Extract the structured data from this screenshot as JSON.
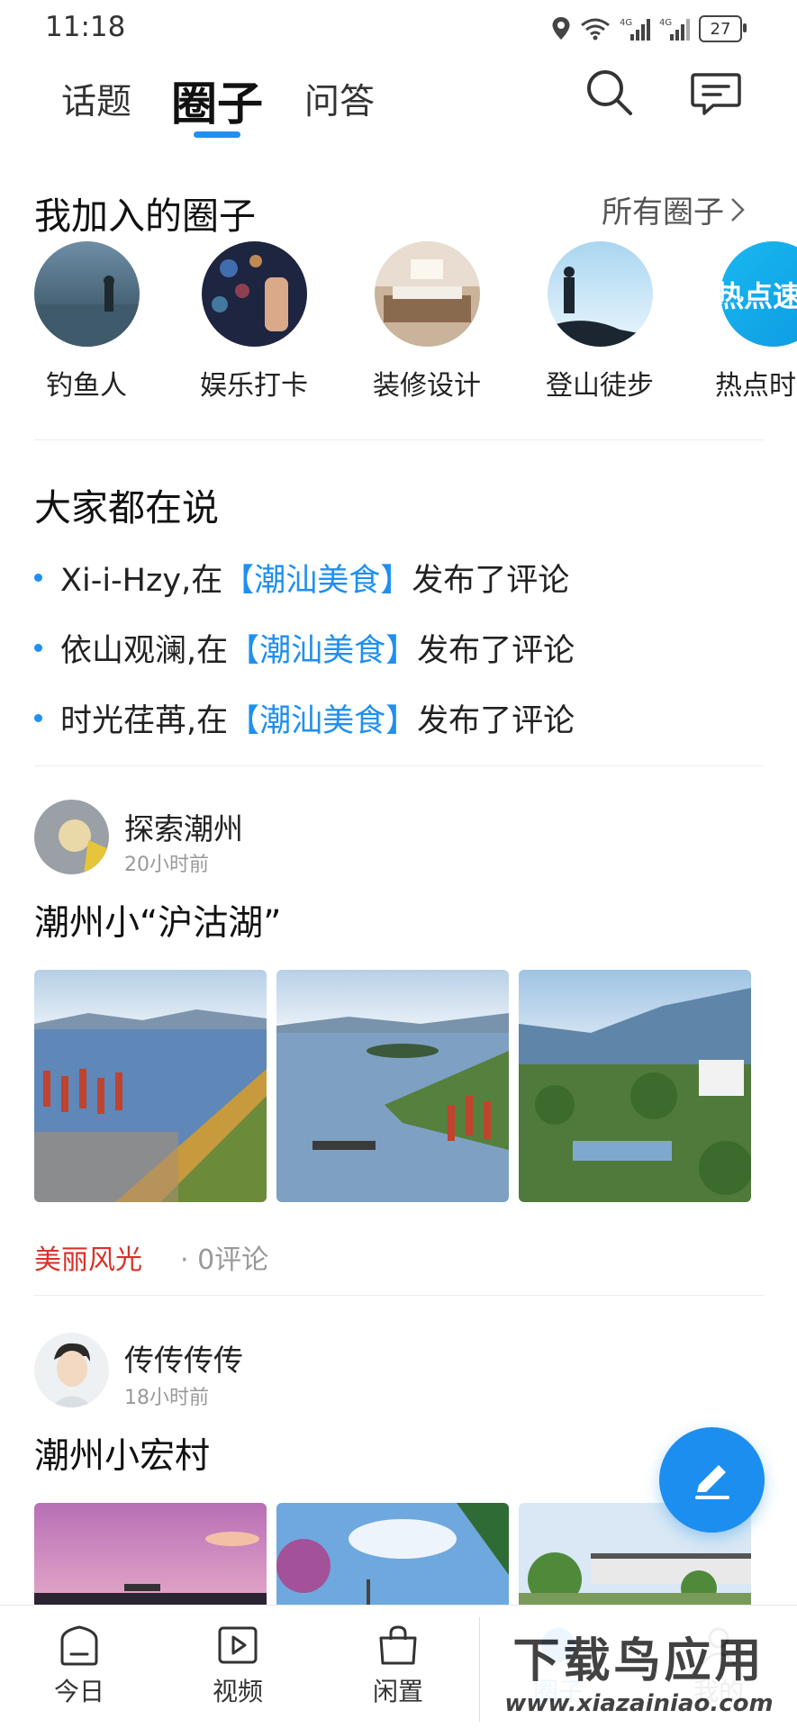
{
  "status_bar": {
    "time": "11:18",
    "battery": "27",
    "network_1": "4G",
    "network_2": "4G"
  },
  "top_tabs": {
    "topics": "话题",
    "circle": "圈子",
    "qa": "问答"
  },
  "joined": {
    "title": "我加入的圈子",
    "all_label": "所有圈子",
    "items": [
      {
        "label": "钓鱼人"
      },
      {
        "label": "娱乐打卡"
      },
      {
        "label": "装修设计"
      },
      {
        "label": "登山徒步"
      },
      {
        "label": "热点时",
        "avatar_text": "热点速"
      }
    ]
  },
  "talk": {
    "title": "大家都在说",
    "rows": [
      {
        "user": "Xi-i-Hzy,在",
        "circle": "【潮汕美食】",
        "action": "发布了评论"
      },
      {
        "user": "依山观澜,在",
        "circle": "【潮汕美食】",
        "action": "发布了评论"
      },
      {
        "user": "时光荏苒,在",
        "circle": "【潮汕美食】",
        "action": "发布了评论"
      }
    ]
  },
  "posts": [
    {
      "author": "探索潮州",
      "time": "20小时前",
      "title": "潮州小“沪沽湖”",
      "tag": "美丽风光",
      "comments": "· 0评论"
    },
    {
      "author": "传传传传",
      "time": "18小时前",
      "title": "潮州小宏村"
    }
  ],
  "bottom_nav": {
    "today": "今日",
    "video": "视频",
    "idle": "闲置",
    "circle": "圈子",
    "mine": "我的"
  },
  "watermark": {
    "line1": "下载鸟应用",
    "line2": "www.xiazainiao.com"
  },
  "colors": {
    "accent": "#1f8ff0",
    "tag": "#d9302a"
  }
}
